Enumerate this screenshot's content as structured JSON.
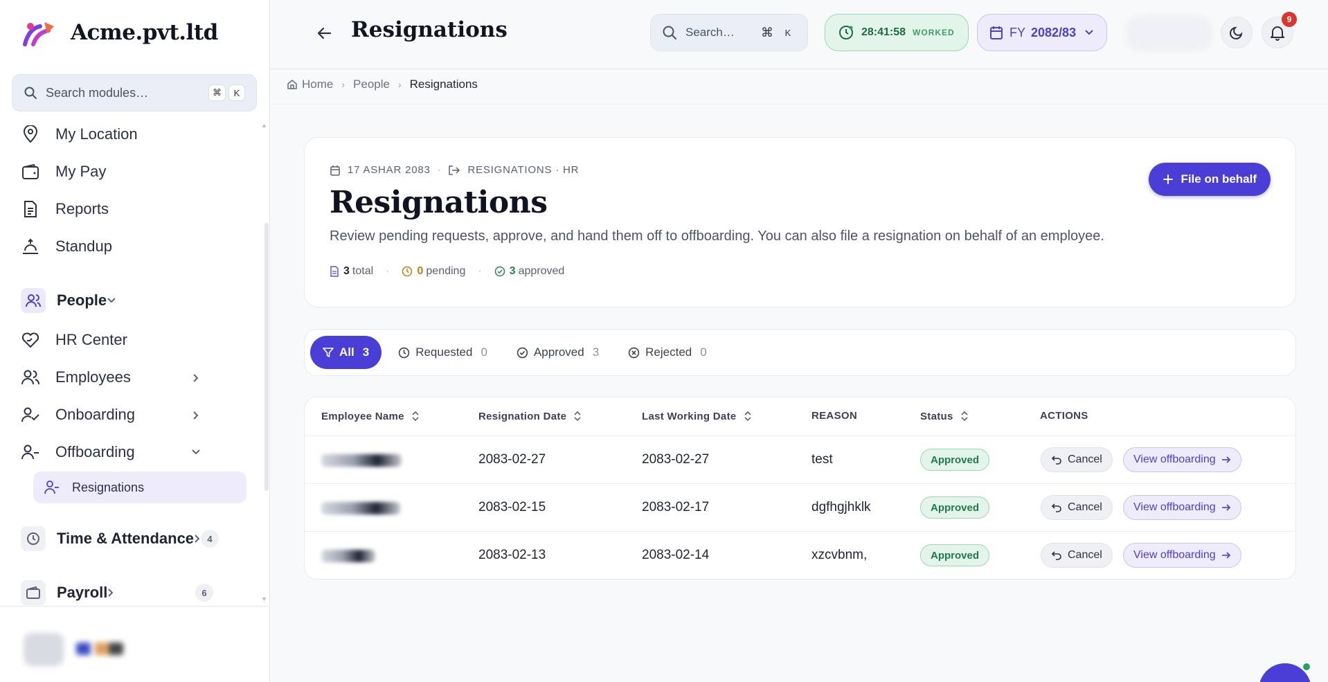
{
  "app": {
    "brand_name": "Acme.pvt.ltd",
    "accent": "#4b3ed6"
  },
  "sidebar": {
    "search_placeholder": "Search modules…",
    "shortcut_cmd": "⌘",
    "shortcut_key": "K",
    "items": [
      {
        "label": "My Location",
        "icon": "map-pin-icon"
      },
      {
        "label": "My Pay",
        "icon": "wallet-icon"
      },
      {
        "label": "Reports",
        "icon": "document-icon"
      },
      {
        "label": "Standup",
        "icon": "sunrise-icon"
      }
    ],
    "group_people": "People",
    "people_items": [
      {
        "label": "HR Center",
        "icon": "heart-hand-icon"
      },
      {
        "label": "Employees",
        "icon": "users-icon"
      },
      {
        "label": "Onboarding",
        "icon": "user-check-icon"
      },
      {
        "label": "Offboarding",
        "icon": "user-minus-icon"
      }
    ],
    "active_sub": "Resignations",
    "group_time": "Time & Attendance",
    "group_time_count": "4",
    "group_payroll": "Payroll",
    "group_payroll_count": "6"
  },
  "topbar": {
    "title": "Resignations",
    "search_placeholder": "Search…",
    "shortcut_cmd": "⌘",
    "shortcut_key": "K",
    "timer_value": "28:41:58",
    "timer_label": "WORKED",
    "fy_prefix": "FY",
    "fy_value": "2082/83",
    "notifications_count": "9"
  },
  "breadcrumb": {
    "home": "Home",
    "parent": "People",
    "current": "Resignations"
  },
  "header": {
    "date": "17 ASHAR 2083",
    "section": "RESIGNATIONS · HR",
    "title": "Resignations",
    "description": "Review pending requests, approve, and hand them off to offboarding. You can also file a resignation on behalf of an employee.",
    "total_count": "3",
    "total_label": "total",
    "pending_count": "0",
    "pending_label": "pending",
    "approved_count": "3",
    "approved_label": "approved",
    "file_button": "File on behalf"
  },
  "filters": [
    {
      "label": "All",
      "count": "3",
      "active": true
    },
    {
      "label": "Requested",
      "count": "0"
    },
    {
      "label": "Approved",
      "count": "3"
    },
    {
      "label": "Rejected",
      "count": "0"
    }
  ],
  "table": {
    "columns": [
      "Employee Name",
      "Resignation Date",
      "Last Working Date",
      "REASON",
      "Status",
      "ACTIONS"
    ],
    "rows": [
      {
        "resignation_date": "2083-02-27",
        "last_working_date": "2083-02-27",
        "reason": "test",
        "status": "Approved"
      },
      {
        "resignation_date": "2083-02-15",
        "last_working_date": "2083-02-17",
        "reason": "dgfhgjhklk",
        "status": "Approved"
      },
      {
        "resignation_date": "2083-02-13",
        "last_working_date": "2083-02-14",
        "reason": "xzcvbnm,",
        "status": "Approved"
      }
    ],
    "cancel_label": "Cancel",
    "view_label": "View offboarding"
  }
}
